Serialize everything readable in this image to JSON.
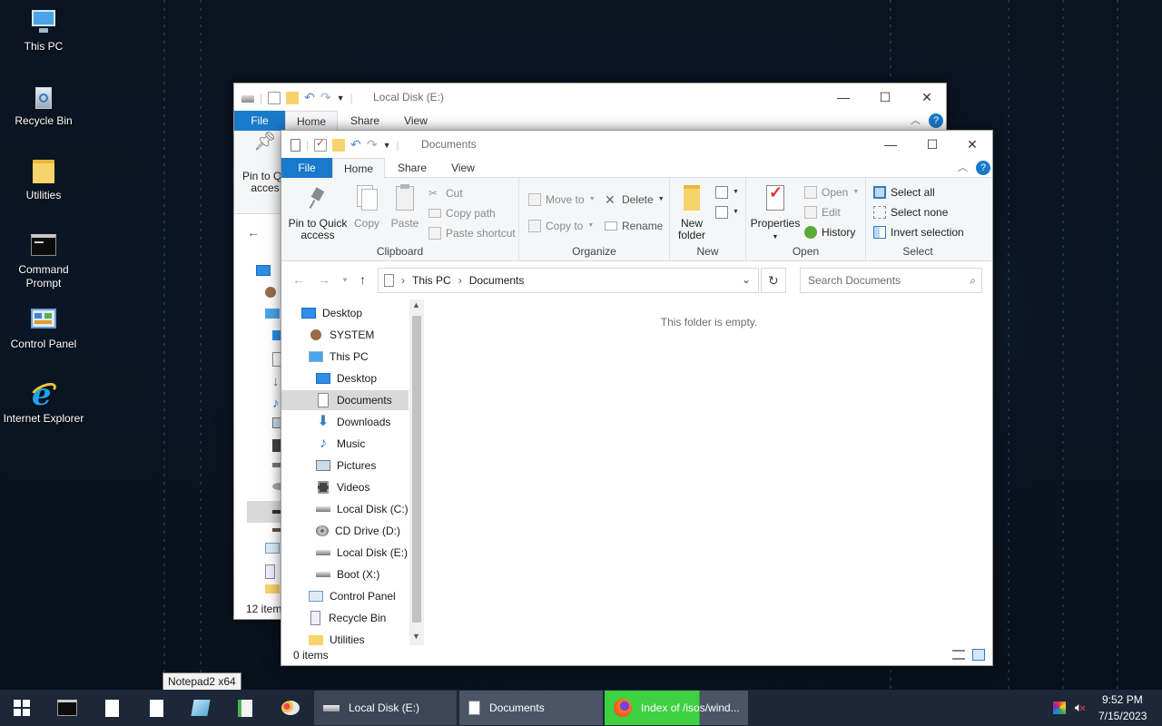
{
  "desktop": {
    "icons": [
      {
        "label": "This PC",
        "icon": "this-pc-icon"
      },
      {
        "label": "Recycle Bin",
        "icon": "recycle-bin-icon"
      },
      {
        "label": "Utilities",
        "icon": "folder-icon"
      },
      {
        "label": "Command Prompt",
        "label_lines": [
          "Command",
          "Prompt"
        ],
        "icon": "command-prompt-icon"
      },
      {
        "label": "Control Panel",
        "icon": "control-panel-icon"
      },
      {
        "label": "Internet Explorer",
        "icon": "internet-explorer-icon"
      }
    ]
  },
  "back_window": {
    "title": "Local Disk (E:)",
    "tabs": [
      "File",
      "Home",
      "Share",
      "View"
    ],
    "pin_label": "Pin to Qu",
    "pin_label2": "acces",
    "status": "12 item"
  },
  "front_window": {
    "title": "Documents",
    "tabs": {
      "file": "File",
      "home": "Home",
      "share": "Share",
      "view": "View"
    },
    "ribbon": {
      "clipboard": {
        "label": "Clipboard",
        "pin": "Pin to Quick",
        "pin2": "access",
        "copy": "Copy",
        "paste": "Paste",
        "cut": "Cut",
        "copy_path": "Copy path",
        "paste_shortcut": "Paste shortcut"
      },
      "organize": {
        "label": "Organize",
        "move_to": "Move to",
        "copy_to": "Copy to",
        "delete": "Delete",
        "rename": "Rename"
      },
      "new": {
        "label": "New",
        "new_folder": "New",
        "new_folder2": "folder"
      },
      "open": {
        "label": "Open",
        "properties": "Properties",
        "open": "Open",
        "edit": "Edit",
        "history": "History"
      },
      "select": {
        "label": "Select",
        "select_all": "Select all",
        "select_none": "Select none",
        "invert": "Invert selection"
      }
    },
    "address": {
      "crumbs": [
        "This PC",
        "Documents"
      ]
    },
    "search_placeholder": "Search Documents",
    "empty_message": "This folder is empty.",
    "status": "0 items",
    "nav_items": [
      {
        "label": "Desktop",
        "icon": "desktop-icon",
        "level": 0
      },
      {
        "label": "SYSTEM",
        "icon": "user-icon",
        "level": 1
      },
      {
        "label": "This PC",
        "icon": "this-pc-icon",
        "level": 1
      },
      {
        "label": "Desktop",
        "icon": "desktop-icon",
        "level": 2
      },
      {
        "label": "Documents",
        "icon": "documents-icon",
        "level": 2,
        "selected": true
      },
      {
        "label": "Downloads",
        "icon": "downloads-icon",
        "level": 2
      },
      {
        "label": "Music",
        "icon": "music-icon",
        "level": 2
      },
      {
        "label": "Pictures",
        "icon": "pictures-icon",
        "level": 2
      },
      {
        "label": "Videos",
        "icon": "videos-icon",
        "level": 2
      },
      {
        "label": "Local Disk (C:)",
        "icon": "drive-icon",
        "level": 2
      },
      {
        "label": "CD Drive (D:)",
        "icon": "cd-drive-icon",
        "level": 2
      },
      {
        "label": "Local Disk (E:)",
        "icon": "drive-icon",
        "level": 2
      },
      {
        "label": "Boot (X:)",
        "icon": "drive-icon",
        "level": 2
      },
      {
        "label": "Control Panel",
        "icon": "control-panel-icon",
        "level": 1
      },
      {
        "label": "Recycle Bin",
        "icon": "recycle-bin-icon",
        "level": 1
      },
      {
        "label": "Utilities",
        "icon": "folder-icon",
        "level": 1
      }
    ]
  },
  "tooltip": "Notepad2 x64",
  "taskbar": {
    "tasks": [
      {
        "label": "Local Disk (E:)",
        "icon": "drive-icon"
      },
      {
        "label": "Documents",
        "icon": "documents-icon"
      },
      {
        "label": "Index of /isos/wind...",
        "icon": "firefox-icon"
      }
    ],
    "time": "9:52 PM",
    "date": "7/15/2023"
  },
  "colors": {
    "accent": "#1979ca",
    "taskbar": "#1c2738",
    "active_task": "#3ed141"
  }
}
